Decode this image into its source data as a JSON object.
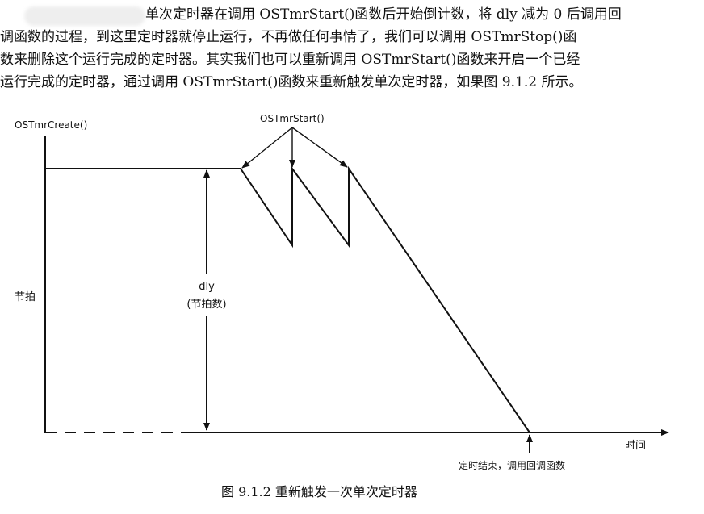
{
  "paragraph": {
    "lines": [
      "单次定时器在调用 OSTmrStart()函数后开始倒计数，将 dly 减为 0 后调用回",
      "调函数的过程，到这里定时器就停止运行，不再做任何事情了，我们可以调用 OSTmrStop()函",
      "数来删除这个运行完成的定时器。其实我们也可以重新调用 OSTmrStart()函数来开启一个已经",
      "运行完成的定时器，通过调用 OSTmrStart()函数来重新触发单次定时器，如果图 9.1.2 所示。"
    ]
  },
  "diagram": {
    "create_label": "OSTmrCreate()",
    "start_label": "OSTmrStart()",
    "y_axis_label": "节拍",
    "dly_label": "dly",
    "dly_sub_label": "(节拍数)",
    "x_axis_label": "时间",
    "end_label": "定时结束，调用回调函数",
    "caption": "图 9.1.2  重新触发一次单次定时器"
  }
}
